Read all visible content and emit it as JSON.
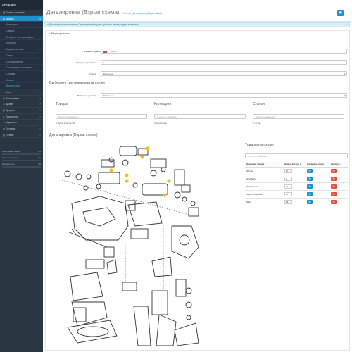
{
  "brand": "OPENCART",
  "sidebar": {
    "items": [
      {
        "icon": "dashboard-icon",
        "glyph": "▦",
        "label": "Панель состояния",
        "arrow": ""
      },
      {
        "icon": "tag-icon",
        "glyph": "◆",
        "label": "Каталог",
        "arrow": "v",
        "active": true
      },
      {
        "icon": "puzzle-icon",
        "glyph": "✚",
        "label": "Блог",
        "arrow": ">"
      },
      {
        "icon": "puzzle-icon",
        "glyph": "✚",
        "label": "Расширения",
        "arrow": ">"
      },
      {
        "icon": "desktop-icon",
        "glyph": "▭",
        "label": "Дизайн",
        "arrow": ">"
      },
      {
        "icon": "cart-icon",
        "glyph": "◧",
        "label": "Продажи",
        "arrow": ">"
      },
      {
        "icon": "user-icon",
        "glyph": "●",
        "label": "Покупатели",
        "arrow": ">"
      },
      {
        "icon": "share-icon",
        "glyph": "◁",
        "label": "Маркетинг",
        "arrow": ">"
      },
      {
        "icon": "gear-icon",
        "glyph": "✱",
        "label": "Система",
        "arrow": ">"
      },
      {
        "icon": "chart-icon",
        "glyph": "▥",
        "label": "Отчеты",
        "arrow": ">"
      }
    ],
    "catalog_sub": [
      {
        "label": "Категории",
        "arrow": ""
      },
      {
        "label": "Товары",
        "arrow": ""
      },
      {
        "label": "Профили повторяющихся",
        "arrow": ""
      },
      {
        "label": "Фильтры",
        "arrow": ""
      },
      {
        "label": "Характеристики",
        "arrow": ">"
      },
      {
        "label": "Опции",
        "arrow": ""
      },
      {
        "label": "Производители",
        "arrow": ""
      },
      {
        "label": "Отзывы для скачивания",
        "arrow": ""
      },
      {
        "label": "Отзывы",
        "arrow": ""
      },
      {
        "label": "Статьи",
        "arrow": ""
      },
      {
        "label": "Взрыв схема",
        "arrow": "",
        "current": true
      }
    ],
    "stats": [
      {
        "label": "Выполненные заказы",
        "value": "0%",
        "progress": 0.0
      },
      {
        "label": "Заказы в процессе",
        "value": "0%",
        "progress": 0.0
      },
      {
        "label": "Другие статусы",
        "value": "0%",
        "progress": 0.0
      }
    ]
  },
  "header": {
    "title": "Деталировка (Взрыв схема)",
    "breadcrumb_home": "Главная",
    "breadcrumb_current": "Деталировка (Взрыв схема)",
    "save_icon": "save-icon",
    "back_icon": "reply-icon"
  },
  "alert": {
    "text": "Для отображения схемы на Странице необходимо добавить вывод модуля в макетах",
    "close": "×"
  },
  "panel": {
    "title": "Редактирование"
  },
  "form": {
    "name_label": "Название взрыв-схемы",
    "flag_icon": "ru-flag-icon",
    "name_value": "MJK 1",
    "sort_label": "Порядок сортировки",
    "sort_value": "1",
    "status_label": "Статус",
    "status_value": "Включено",
    "where_heading": "Выберите где показывать схему",
    "output_label": "Вывод по условию",
    "output_value": "Включено"
  },
  "columns": [
    {
      "title": "Товары",
      "placeholder": "Поиск по названию",
      "tags": [
        "Apple Cinema 30\""
      ]
    },
    {
      "title": "Категории",
      "placeholder": "Поиск по названию",
      "tags": [
        "Мониторы"
      ]
    },
    {
      "title": "Статьи",
      "placeholder": "Поиск по названию",
      "tags": [
        "О нас"
      ]
    }
  ],
  "schema_heading": "Деталировка (Взрыв схема)",
  "products": {
    "heading": "Товары на схеме",
    "search_placeholder": "Поиск по названию",
    "col_name": "Название товара",
    "col_num": "Номер детали",
    "col_add": "Добавить точки",
    "col_del": "Удалить",
    "rows": [
      {
        "name": "iPhone",
        "num": "27"
      },
      {
        "name": "iPod Nano",
        "num": "2"
      },
      {
        "name": "iPod Classic",
        "num": "23"
      },
      {
        "name": "Apple Cinema 30\"",
        "num": "90"
      },
      {
        "name": "iMac",
        "num": "15"
      }
    ]
  },
  "colors": {
    "sidebar": "#2b3643",
    "accent": "#1e91cf",
    "danger": "#e3503e",
    "marker": "#f3c01b"
  }
}
